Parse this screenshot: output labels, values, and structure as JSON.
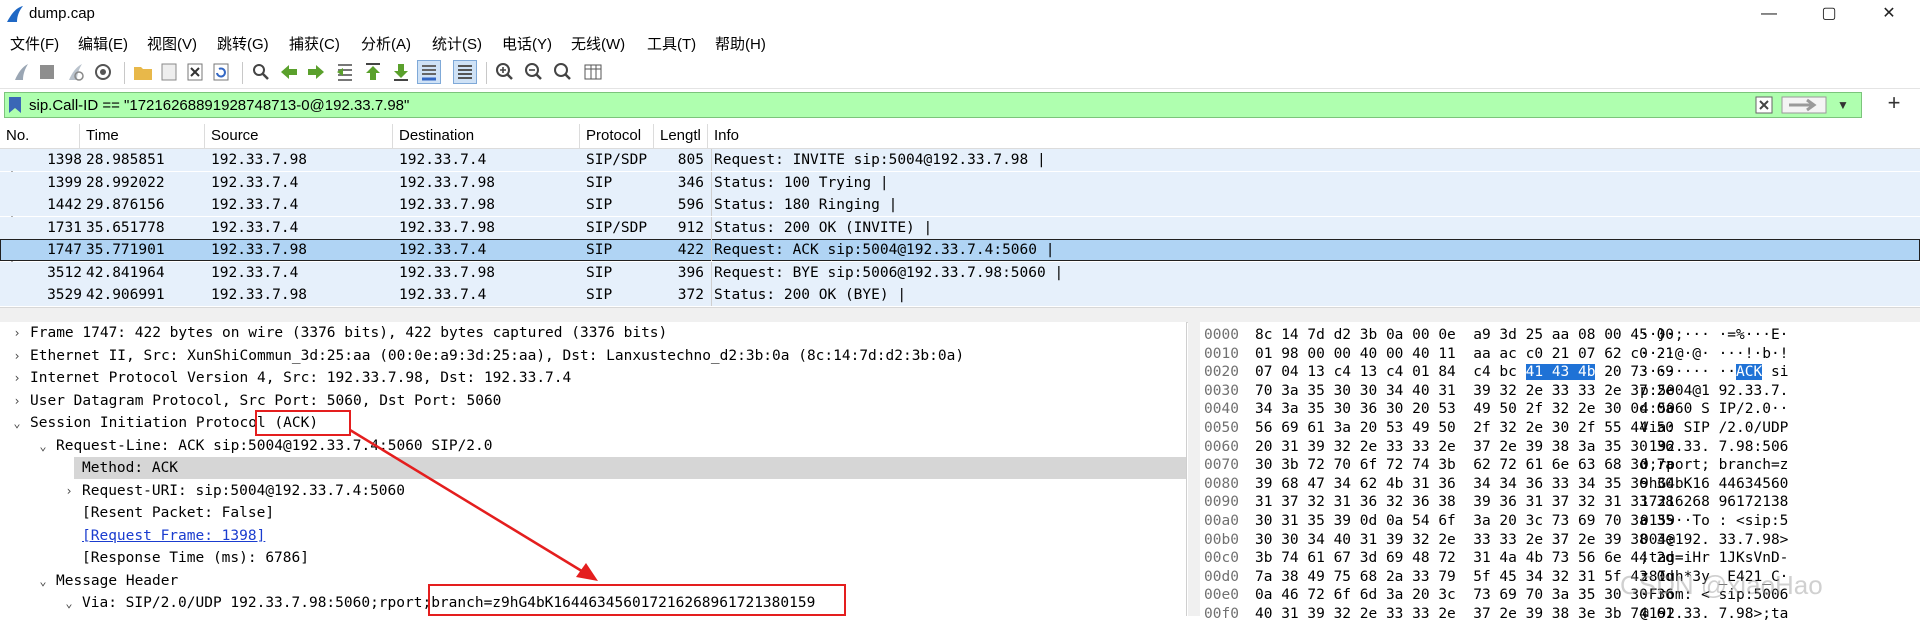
{
  "window": {
    "title": "dump.cap",
    "controls": [
      "—",
      "▢",
      "✕"
    ]
  },
  "menu": [
    "文件(F)",
    "编辑(E)",
    "视图(V)",
    "跳转(G)",
    "捕获(C)",
    "分析(A)",
    "统计(S)",
    "电话(Y)",
    "无线(W)",
    "工具(T)",
    "帮助(H)"
  ],
  "filter": {
    "value": "sip.Call-ID == \"17216268891928748713-0@192.33.7.98\""
  },
  "packet_list": {
    "columns": [
      "No.",
      "Time",
      "Source",
      "Destination",
      "Protocol",
      "Lengtl",
      "Info"
    ],
    "rows": [
      {
        "no": "1398",
        "time": "28.985851",
        "src": "192.33.7.98",
        "dst": "192.33.7.4",
        "proto": "SIP/SDP",
        "len": "805",
        "info": "Request: INVITE sip:5004@192.33.7.98 |"
      },
      {
        "no": "1399",
        "time": "28.992022",
        "src": "192.33.7.4",
        "dst": "192.33.7.98",
        "proto": "SIP",
        "len": "346",
        "info": "Status: 100 Trying |"
      },
      {
        "no": "1442",
        "time": "29.876156",
        "src": "192.33.7.4",
        "dst": "192.33.7.98",
        "proto": "SIP",
        "len": "596",
        "info": "Status: 180 Ringing |"
      },
      {
        "no": "1731",
        "time": "35.651778",
        "src": "192.33.7.4",
        "dst": "192.33.7.98",
        "proto": "SIP/SDP",
        "len": "912",
        "info": "Status: 200 OK (INVITE) |"
      },
      {
        "no": "1747",
        "time": "35.771901",
        "src": "192.33.7.98",
        "dst": "192.33.7.4",
        "proto": "SIP",
        "len": "422",
        "info": "Request: ACK sip:5004@192.33.7.4:5060 |"
      },
      {
        "no": "3512",
        "time": "42.841964",
        "src": "192.33.7.4",
        "dst": "192.33.7.98",
        "proto": "SIP",
        "len": "396",
        "info": "Request: BYE sip:5006@192.33.7.98:5060 |"
      },
      {
        "no": "3529",
        "time": "42.906991",
        "src": "192.33.7.98",
        "dst": "192.33.7.4",
        "proto": "SIP",
        "len": "372",
        "info": "Status: 200 OK (BYE) |"
      }
    ],
    "selected_no": "1747"
  },
  "details": [
    {
      "toggle": "›",
      "text": "Frame 1747: 422 bytes on wire (3376 bits), 422 bytes captured (3376 bits)"
    },
    {
      "toggle": "›",
      "text": "Ethernet II, Src: XunShiCommun_3d:25:aa (00:0e:a9:3d:25:aa), Dst: Lanxustechno_d2:3b:0a (8c:14:7d:d2:3b:0a)"
    },
    {
      "toggle": "›",
      "text": "Internet Protocol Version 4, Src: 192.33.7.98, Dst: 192.33.7.4"
    },
    {
      "toggle": "›",
      "text": "User Datagram Protocol, Src Port: 5060, Dst Port: 5060"
    },
    {
      "toggle": "⌄",
      "text": "Session Initiation Protocol (ACK)"
    },
    {
      "toggle": "⌄",
      "text": "Request-Line: ACK sip:5004@192.33.7.4:5060 SIP/2.0"
    },
    {
      "toggle": "",
      "text": "Method: ACK"
    },
    {
      "toggle": "›",
      "text": "Request-URI: sip:5004@192.33.7.4:5060"
    },
    {
      "toggle": "",
      "text": "[Resent Packet: False]"
    },
    {
      "toggle": "",
      "text": "[Request Frame: 1398]"
    },
    {
      "toggle": "",
      "text": "[Response Time (ms): 6786]"
    },
    {
      "toggle": "⌄",
      "text": "Message Header"
    },
    {
      "toggle": "⌄",
      "text": "Via: SIP/2.0/UDP 192.33.7.98:5060;rport;branch=z9hG4bK1644634560172162689617213801​59"
    }
  ],
  "hex": [
    {
      "off": "0000",
      "bytes": "8c 14 7d d2 3b 0a 00 0e  a9 3d 25 aa 08 00 45 00",
      "ascii": "··}·;··· ·=%···E·"
    },
    {
      "off": "0010",
      "bytes": "01 98 00 00 40 00 40 11  aa ac c0 21 07 62 c0 21",
      "ascii": "····@·@· ···!·b·!"
    },
    {
      "off": "0020",
      "bytes": "07 04 13 c4 13 c4 01 84  c4 bc 41 43 4b 20 73 69",
      "ascii": "········ ··ACK si"
    },
    {
      "off": "0030",
      "bytes": "70 3a 35 30 30 34 40 31  39 32 2e 33 33 2e 37 2e",
      "ascii": "p:5004@1 92.33.7."
    },
    {
      "off": "0040",
      "bytes": "34 3a 35 30 36 30 20 53  49 50 2f 32 2e 30 0d 0a",
      "ascii": "4:5060 S IP/2.0··"
    },
    {
      "off": "0050",
      "bytes": "56 69 61 3a 20 53 49 50  2f 32 2e 30 2f 55 44 50",
      "ascii": "Via: SIP /2.0/UDP"
    },
    {
      "off": "0060",
      "bytes": "20 31 39 32 2e 33 33 2e  37 2e 39 38 3a 35 30 36",
      "ascii": " 192.33. 7.98:506"
    },
    {
      "off": "0070",
      "bytes": "30 3b 72 70 6f 72 74 3b  62 72 61 6e 63 68 3d 7a",
      "ascii": "0;rport; branch=z"
    },
    {
      "off": "0080",
      "bytes": "39 68 47 34 62 4b 31 36  34 34 36 33 34 35 36 30",
      "ascii": "9hG4bK16 44634560"
    },
    {
      "off": "0090",
      "bytes": "31 37 32 31 36 32 36 38  39 36 31 37 32 31 33 38",
      "ascii": "17216268 96172138"
    },
    {
      "off": "00a0",
      "bytes": "30 31 35 39 0d 0a 54 6f  3a 20 3c 73 69 70 3a 35",
      "ascii": "0159··To : <sip:5"
    },
    {
      "off": "00b0",
      "bytes": "30 30 34 40 31 39 32 2e  33 33 2e 37 2e 39 38 3e",
      "ascii": "004@192. 33.7.98>"
    },
    {
      "off": "00c0",
      "bytes": "3b 74 61 67 3d 69 48 72  31 4a 4b 73 56 6e 44 2d",
      "ascii": ";tag=iHr 1JKsVnD-"
    },
    {
      "off": "00d0",
      "bytes": "7a 38 49 75 68 2a 33 79  5f 45 34 32 31 5f 43 0d",
      "ascii": "z8Iuh*3y _E421_C·"
    },
    {
      "off": "00e0",
      "bytes": "0a 46 72 6f 6d 3a 20 3c  73 69 70 3a 35 30 30 36",
      "ascii": "·From: < sip:5006"
    },
    {
      "off": "00f0",
      "bytes": "40 31 39 32 2e 33 33 2e  37 2e 39 38 3e 3b 74 61",
      "ascii": "@192.33. 7.98>;ta"
    }
  ],
  "watermark": "CSDN @xiaoHao",
  "colors": {
    "filter_ok": "#afffaf",
    "row_bg": "#e6f0fb",
    "row_selected": "#b0d4f4",
    "hex_highlight": "#1f72d6",
    "annotation": "#e41e1e"
  }
}
